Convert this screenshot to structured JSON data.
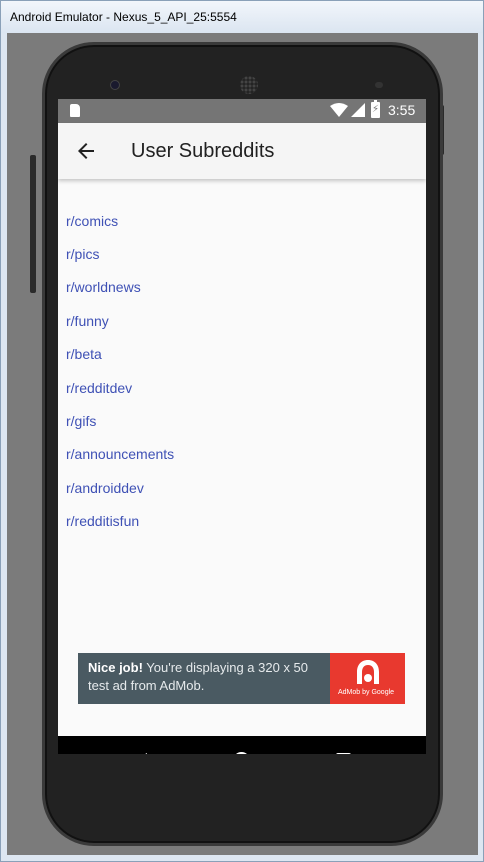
{
  "window": {
    "title": "Android Emulator - Nexus_5_API_25:5554"
  },
  "statusbar": {
    "time": "3:55",
    "icons": [
      "sd-card-icon",
      "wifi-icon",
      "signal-icon",
      "battery-charging-icon"
    ]
  },
  "appbar": {
    "title": "User Subreddits",
    "back_icon": "arrow-back-icon"
  },
  "subreddits": [
    "r/comics",
    "r/pics",
    "r/worldnews",
    "r/funny",
    "r/beta",
    "r/redditdev",
    "r/gifs",
    "r/announcements",
    "r/androiddev",
    "r/redditisfun"
  ],
  "ad": {
    "headline": "Nice job!",
    "body": " You're displaying a 320 x 50 test ad from AdMob.",
    "brand": "AdMob by Google"
  },
  "colors": {
    "link": "#3f51b5",
    "statusbar": "#757575",
    "appbar": "#f5f5f5",
    "ad_bg": "#4a5a62",
    "ad_logo": "#e8392f"
  },
  "navbar": {
    "buttons": [
      "back-button",
      "home-button",
      "recents-button"
    ]
  }
}
